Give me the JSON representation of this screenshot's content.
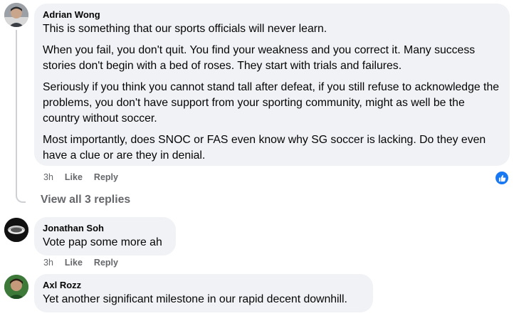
{
  "comments": [
    {
      "author": "Adrian Wong",
      "paragraphs": [
        "This is something that our sports officials will never learn.",
        "When you fail, you don't quit. You find your weakness and you correct it. Many success stories don't begin with a bed of roses. They start with trials and failures.",
        "Seriously if you think you cannot stand tall after defeat, if you still refuse to acknowledge the problems, you don't have support from your sporting community, might as well be the country without soccer.",
        "Most importantly, does SNOC or FAS even know why SG soccer is lacking. Do they even have a clue or are they in denial."
      ],
      "time": "3h",
      "like_label": "Like",
      "reply_label": "Reply",
      "reaction_icon": "like-reaction-icon"
    },
    {
      "author": "Jonathan Soh",
      "paragraphs": [
        "Vote pap some more ah"
      ],
      "time": "3h",
      "like_label": "Like",
      "reply_label": "Reply"
    },
    {
      "author": "Axl Rozz",
      "paragraphs": [
        "Yet another significant milestone in our rapid decent downhill."
      ]
    }
  ],
  "view_replies": "View all 3 replies",
  "colors": {
    "bubble": "#f0f2f5",
    "secondary_text": "#65676b",
    "like_blue": "#1877f2"
  }
}
